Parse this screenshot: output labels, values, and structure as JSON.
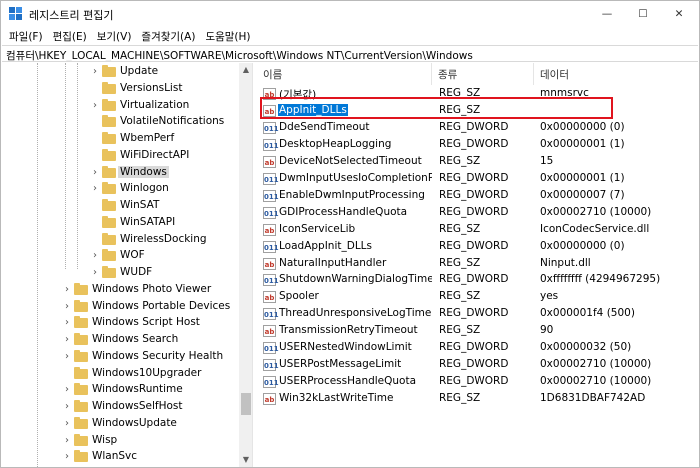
{
  "window": {
    "title": "레지스트리 편집기",
    "controls": {
      "minimize": "—",
      "maximize": "☐",
      "close": "✕"
    }
  },
  "menu": [
    "파일(F)",
    "편집(E)",
    "보기(V)",
    "즐겨찾기(A)",
    "도움말(H)"
  ],
  "address": "컴퓨터\\HKEY_LOCAL_MACHINE\\SOFTWARE\\Microsoft\\Windows NT\\CurrentVersion\\Windows",
  "tree": {
    "items": [
      {
        "label": "Update",
        "expandable": true,
        "depth": 1
      },
      {
        "label": "VersionsList",
        "expandable": false,
        "depth": 1
      },
      {
        "label": "Virtualization",
        "expandable": true,
        "depth": 1
      },
      {
        "label": "VolatileNotifications",
        "expandable": false,
        "depth": 1
      },
      {
        "label": "WbemPerf",
        "expandable": false,
        "depth": 1
      },
      {
        "label": "WiFiDirectAPI",
        "expandable": false,
        "depth": 1
      },
      {
        "label": "Windows",
        "expandable": true,
        "depth": 1,
        "selected": true
      },
      {
        "label": "Winlogon",
        "expandable": true,
        "depth": 1
      },
      {
        "label": "WinSAT",
        "expandable": false,
        "depth": 1
      },
      {
        "label": "WinSATAPI",
        "expandable": false,
        "depth": 1
      },
      {
        "label": "WirelessDocking",
        "expandable": false,
        "depth": 1
      },
      {
        "label": "WOF",
        "expandable": true,
        "depth": 1
      },
      {
        "label": "WUDF",
        "expandable": true,
        "depth": 1
      },
      {
        "label": "Windows Photo Viewer",
        "expandable": true,
        "depth": 0
      },
      {
        "label": "Windows Portable Devices",
        "expandable": true,
        "depth": 0
      },
      {
        "label": "Windows Script Host",
        "expandable": true,
        "depth": 0
      },
      {
        "label": "Windows Search",
        "expandable": true,
        "depth": 0
      },
      {
        "label": "Windows Security Health",
        "expandable": true,
        "depth": 0
      },
      {
        "label": "Windows10Upgrader",
        "expandable": false,
        "depth": 0
      },
      {
        "label": "WindowsRuntime",
        "expandable": true,
        "depth": 0
      },
      {
        "label": "WindowsSelfHost",
        "expandable": true,
        "depth": 0
      },
      {
        "label": "WindowsUpdate",
        "expandable": true,
        "depth": 0
      },
      {
        "label": "Wisp",
        "expandable": true,
        "depth": 0
      },
      {
        "label": "WlanSvc",
        "expandable": true,
        "depth": 0
      }
    ]
  },
  "columns": {
    "name": "이름",
    "type": "종류",
    "data": "데이터"
  },
  "values": [
    {
      "name": "(기본값)",
      "type": "REG_SZ",
      "data": "mnmsrvc",
      "kind": "sz"
    },
    {
      "name": "AppInit_DLLs",
      "type": "REG_SZ",
      "data": "",
      "kind": "sz",
      "selected": true
    },
    {
      "name": "DdeSendTimeout",
      "type": "REG_DWORD",
      "data": "0x00000000 (0)",
      "kind": "dw"
    },
    {
      "name": "DesktopHeapLogging",
      "type": "REG_DWORD",
      "data": "0x00000001 (1)",
      "kind": "dw"
    },
    {
      "name": "DeviceNotSelectedTimeout",
      "type": "REG_SZ",
      "data": "15",
      "kind": "sz"
    },
    {
      "name": "DwmInputUsesIoCompletionP...",
      "type": "REG_DWORD",
      "data": "0x00000001 (1)",
      "kind": "dw"
    },
    {
      "name": "EnableDwmInputProcessing",
      "type": "REG_DWORD",
      "data": "0x00000007 (7)",
      "kind": "dw"
    },
    {
      "name": "GDIProcessHandleQuota",
      "type": "REG_DWORD",
      "data": "0x00002710 (10000)",
      "kind": "dw"
    },
    {
      "name": "IconServiceLib",
      "type": "REG_SZ",
      "data": "IconCodecService.dll",
      "kind": "sz"
    },
    {
      "name": "LoadAppInit_DLLs",
      "type": "REG_DWORD",
      "data": "0x00000000 (0)",
      "kind": "dw"
    },
    {
      "name": "NaturalInputHandler",
      "type": "REG_SZ",
      "data": "Ninput.dll",
      "kind": "sz"
    },
    {
      "name": "ShutdownWarningDialogTime...",
      "type": "REG_DWORD",
      "data": "0xffffffff (4294967295)",
      "kind": "dw"
    },
    {
      "name": "Spooler",
      "type": "REG_SZ",
      "data": "yes",
      "kind": "sz"
    },
    {
      "name": "ThreadUnresponsiveLogTime...",
      "type": "REG_DWORD",
      "data": "0x000001f4 (500)",
      "kind": "dw"
    },
    {
      "name": "TransmissionRetryTimeout",
      "type": "REG_SZ",
      "data": "90",
      "kind": "sz"
    },
    {
      "name": "USERNestedWindowLimit",
      "type": "REG_DWORD",
      "data": "0x00000032 (50)",
      "kind": "dw"
    },
    {
      "name": "USERPostMessageLimit",
      "type": "REG_DWORD",
      "data": "0x00002710 (10000)",
      "kind": "dw"
    },
    {
      "name": "USERProcessHandleQuota",
      "type": "REG_DWORD",
      "data": "0x00002710 (10000)",
      "kind": "dw"
    },
    {
      "name": "Win32kLastWriteTime",
      "type": "REG_SZ",
      "data": "1D6831DBAF742AD",
      "kind": "sz"
    }
  ],
  "icons": {
    "sz": "ab",
    "dw": "011"
  }
}
